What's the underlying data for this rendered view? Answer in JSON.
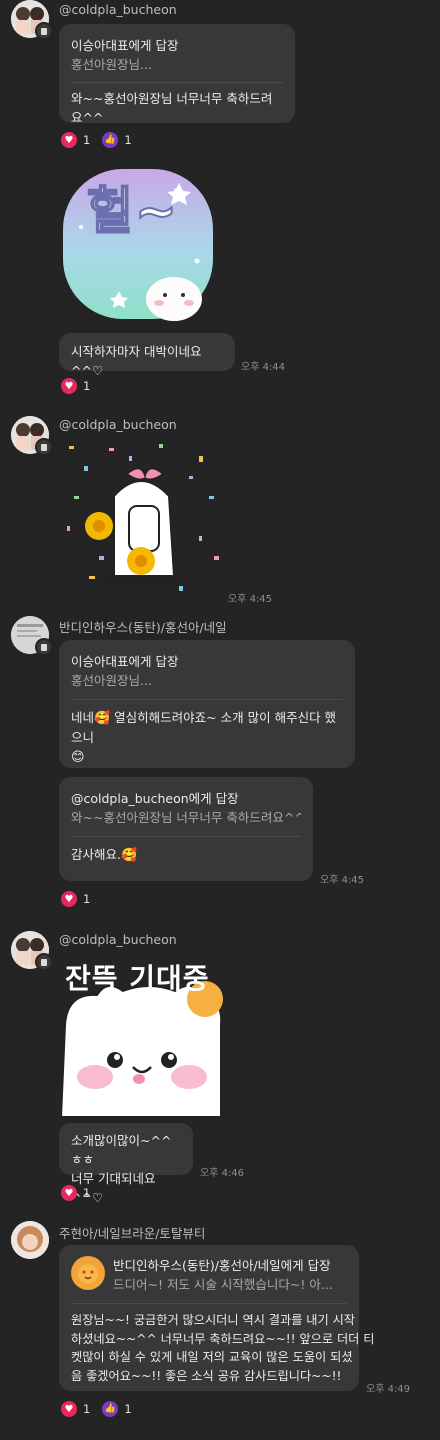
{
  "messages": {
    "m1": {
      "sender": "@coldpla_bucheon",
      "reply_to": "이승아대표에게 답장",
      "reply_quote": "홍선아원장님...",
      "text": "와~~홍선아원장님 너무너무 축하드려요^^",
      "reactions": [
        {
          "icon": "heart-icon",
          "count": "1"
        },
        {
          "icon": "thumbs-up-icon",
          "count": "1"
        }
      ]
    },
    "m2": {
      "sticker_text": "헐~",
      "text": "시작하자마자 대박이네요^^♡",
      "time": "오후 4:44",
      "reactions": [
        {
          "icon": "heart-icon",
          "count": "1"
        }
      ]
    },
    "m3": {
      "sender": "@coldpla_bucheon",
      "time": "오후 4:45"
    },
    "m4": {
      "sender": "반디인하우스(동탄)/홍선아/네일",
      "reply_to": "이승아대표에게 답장",
      "reply_quote": "홍선아원장님...",
      "text_line1": "네네",
      "text_line1_rest": " 열심히해드려야죠~ 소개 많이 해주신다 했으니",
      "emoji_smile": "😊",
      "emoji_love": "🥰"
    },
    "m5": {
      "reply_to": "@coldpla_bucheon에게 답장",
      "reply_quote": "와~~홍선아원장님 너무너무 축하드려요^^",
      "text": "감사해요.",
      "emoji": "🥰",
      "time": "오후 4:45",
      "reactions": [
        {
          "icon": "heart-icon",
          "count": "1"
        }
      ]
    },
    "m6": {
      "sender": "@coldpla_bucheon",
      "sticker_text": "잔뜩 기대중",
      "text_line1": "소개많이많이~^^ㅎㅎ",
      "text_line2": "너무 기대되네요^^♡",
      "time": "오후 4:46",
      "reactions": [
        {
          "icon": "heart-icon",
          "count": "1"
        }
      ]
    },
    "m7": {
      "sender": "주현아/네일브라운/토탈뷰티",
      "reply_to": "반디인하우스(동탄)/홍선아/네일에게 답장",
      "reply_quote": "드디어~! 저도 시술 시작했습니다~! 아...",
      "text_line1": "원장님~~! 궁금한거 많으시더니 역시 결과를 내기 시작",
      "text_line2": "하셨네요~~^^ 너무너무 축하드려요~~!! 앞으로 더더 티",
      "text_line3": "켓많이 하실 수 있게 내일 저의 교육이 많은 도움이 되셨",
      "text_line4": "음 좋겠어요~~!! 좋은 소식 공유 감사드립니다~~!!",
      "time": "오후 4:49",
      "reactions": [
        {
          "icon": "heart-icon",
          "count": "1"
        },
        {
          "icon": "thumbs-up-icon",
          "count": "1"
        }
      ]
    }
  },
  "colors": {
    "background": "#242424",
    "bubble": "#383838",
    "heart": "#e6285c",
    "thumb": "#7a3cc7"
  }
}
